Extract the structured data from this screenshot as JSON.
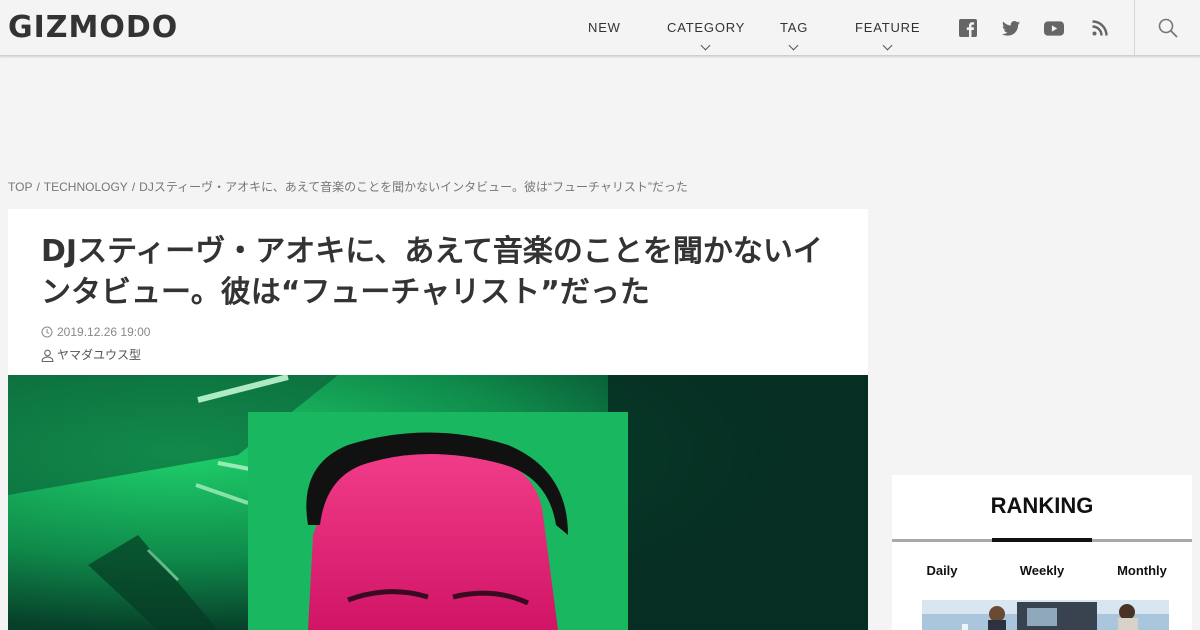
{
  "header": {
    "logo": "GIZMODO",
    "nav": [
      {
        "label": "NEW"
      },
      {
        "label": "CATEGORY"
      },
      {
        "label": "TAG"
      },
      {
        "label": "FEATURE"
      }
    ],
    "social_icons": [
      "facebook-icon",
      "twitter-icon",
      "youtube-icon",
      "rss-icon"
    ],
    "search_icon": "search-icon"
  },
  "breadcrumb": {
    "items": [
      "TOP",
      "TECHNOLOGY",
      "DJスティーヴ・アオキに、あえて音楽のことを聞かないインタビュー。彼は“フューチャリスト”だった"
    ],
    "separator": "/"
  },
  "article": {
    "title": "DJスティーヴ・アオキに、あえて音楽のことを聞かないインタビュー。彼は“フューチャリスト”だった",
    "date": "2019.12.26 19:00",
    "author": "ヤマダユウス型"
  },
  "ranking": {
    "title": "RANKING",
    "tabs": [
      "Daily",
      "Weekly",
      "Monthly"
    ],
    "active_tab": "Weekly"
  },
  "colors": {
    "background": "#f4f4f4",
    "card": "#ffffff",
    "text": "#333333",
    "hero_green": "#14a85a",
    "hero_magenta": "#e8196e"
  }
}
